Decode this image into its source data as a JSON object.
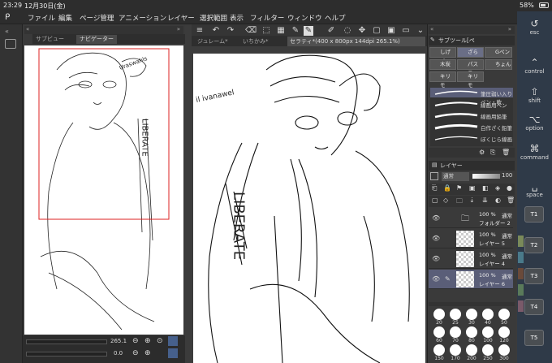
{
  "status": {
    "time": "23:29",
    "date": "12月30日(金)",
    "battery": "58%"
  },
  "menu": [
    "ファイル",
    "編集",
    "ページ管理",
    "アニメーション",
    "レイヤー",
    "選択範囲",
    "表示",
    "フィルター",
    "ウィンドウ",
    "ヘルプ"
  ],
  "nav_tabs": [
    "サブビュー",
    "ナビゲーター"
  ],
  "nav": {
    "zoom": "265.1",
    "rotation": "0.0"
  },
  "doc_tabs": [
    "ジュレーム*",
    "いちかみ*",
    "セラティ*(400 x 800px 144dpi 265.1%)"
  ],
  "subtool_header": "サブツール[ペ",
  "subtool_chips": [
    {
      "label": "しげペ"
    },
    {
      "label": "ざらつ"
    },
    {
      "label": "Gペン"
    },
    {
      "label": "木炭"
    },
    {
      "label": "パステ"
    },
    {
      "label": "ちょん"
    },
    {
      "label": "キリモ"
    },
    {
      "label": "キリモ"
    }
  ],
  "brushes": [
    "筆圧弱い入りペン・軟",
    "線画用ペン",
    "線画用鉛筆",
    "白作ざく鉛筆",
    "ぼくじら線画"
  ],
  "layer_header": "レイヤー",
  "layer_controls": {
    "blend": "通常",
    "opacity": "100"
  },
  "layers": [
    {
      "opacity": "100 %",
      "mode": "通常",
      "name": "フォルダー 2",
      "selected": false
    },
    {
      "opacity": "100 %",
      "mode": "通常",
      "name": "レイヤー 5",
      "selected": false
    },
    {
      "opacity": "100 %",
      "mode": "通常",
      "name": "レイヤー 4",
      "selected": false
    },
    {
      "opacity": "100 %",
      "mode": "通常",
      "name": "レイヤー 6",
      "selected": true
    }
  ],
  "brush_sizes": [
    "20",
    "25",
    "30",
    "40",
    "50",
    "60",
    "70",
    "80",
    "100",
    "120",
    "150",
    "170",
    "200",
    "250",
    "300"
  ],
  "keys": [
    {
      "icon": "esc-icon",
      "label": "esc"
    },
    {
      "icon": "control-icon",
      "label": "control"
    },
    {
      "icon": "shift-icon",
      "label": "shift"
    },
    {
      "icon": "option-icon",
      "label": "option"
    },
    {
      "icon": "command-icon",
      "label": "command"
    },
    {
      "icon": "space-icon",
      "label": "space"
    }
  ],
  "tkeys": [
    "T1",
    "T2",
    "T3",
    "T4",
    "T5"
  ],
  "sketch_text": {
    "nav_left": "Uraswahls",
    "canvas_left": "il ivanawel",
    "vertical": "LIBERATE"
  }
}
